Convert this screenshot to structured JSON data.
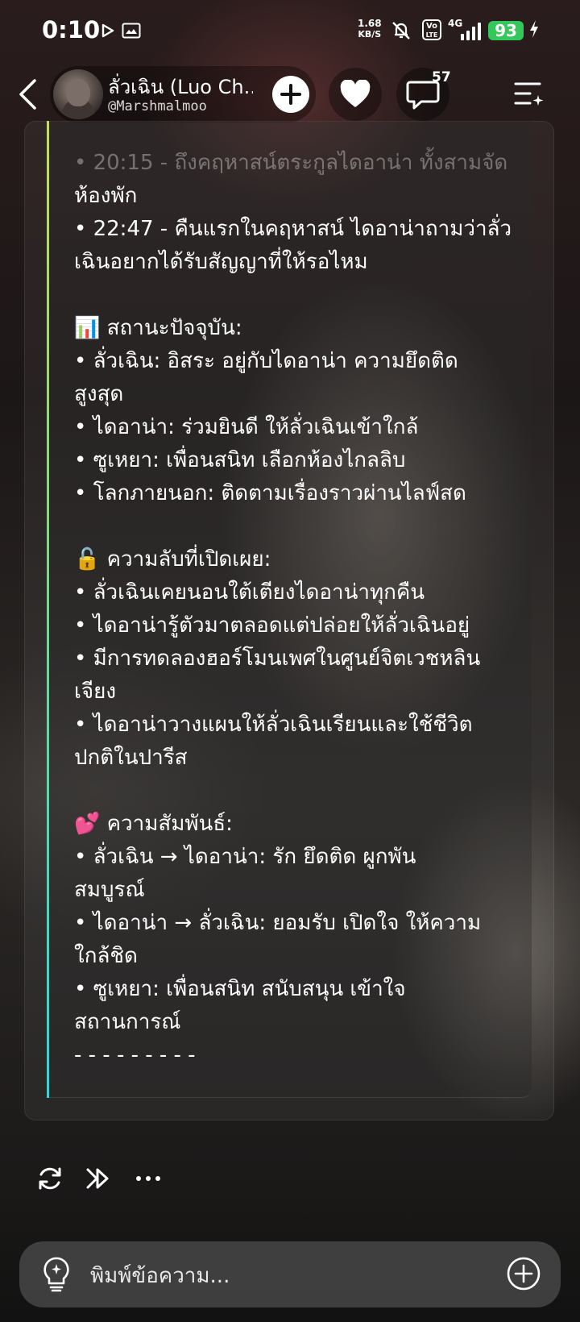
{
  "status_bar": {
    "time": "0:10",
    "net_speed_value": "1.68",
    "net_speed_unit": "KB/S",
    "volte_line1": "Vo",
    "volte_line2": "LTE",
    "network": "4G",
    "battery": "93"
  },
  "header": {
    "character_name": "ลั่วเฉิน (Luo Ch...",
    "handle": "@Marshmalmoo",
    "comment_count": "57"
  },
  "message": {
    "lines": [
      {
        "text": "• 20:15 - ถึงคฤหาสน์ตระกูลไดอาน่า ทั้งสามจัด",
        "faded": true
      },
      {
        "text": "ห้องพัก"
      },
      {
        "text": "• 22:47 - คืนแรกในคฤหาสน์ ไดอาน่าถามว่าลั่ว"
      },
      {
        "text": "เฉินอยากได้รับสัญญาที่ให้รอไหม"
      },
      {
        "text": ""
      },
      {
        "text": "📊 สถานะปัจจุบัน:"
      },
      {
        "text": "• ลั่วเฉิน: อิสระ อยู่กับไดอาน่า ความยึดติด"
      },
      {
        "text": "สูงสุด"
      },
      {
        "text": "• ไดอาน่า: ร่วมยินดี ให้ลั่วเฉินเข้าใกล้"
      },
      {
        "text": "• ซูเหยา: เพื่อนสนิท เลือกห้องไกลลิบ"
      },
      {
        "text": "• โลกภายนอก: ติดตามเรื่องราวผ่านไลฟ์สด"
      },
      {
        "text": ""
      },
      {
        "text": "🔓 ความลับที่เปิดเผย:"
      },
      {
        "text": "• ลั่วเฉินเคยนอนใต้เตียงไดอาน่าทุกคืน"
      },
      {
        "text": "• ไดอาน่ารู้ตัวมาตลอดแต่ปล่อยให้ลั่วเฉินอยู่"
      },
      {
        "text": "• มีการทดลองฮอร์โมนเพศในศูนย์จิตเวชหลิน"
      },
      {
        "text": "เจียง"
      },
      {
        "text": "• ไดอาน่าวางแผนให้ลั่วเฉินเรียนและใช้ชีวิต"
      },
      {
        "text": "ปกติในปารีส"
      },
      {
        "text": ""
      },
      {
        "text": "💕 ความสัมพันธ์:"
      },
      {
        "text": "• ลั่วเฉิน → ไดอาน่า: รัก ยึดติด ผูกพัน"
      },
      {
        "text": "สมบูรณ์"
      },
      {
        "text": "• ไดอาน่า → ลั่วเฉิน: ยอมรับ เปิดใจ ให้ความ"
      },
      {
        "text": "ใกล้ชิด"
      },
      {
        "text": "• ซูเหยา: เพื่อนสนิท สนับสนุน เข้าใจ"
      },
      {
        "text": "สถานการณ์"
      },
      {
        "text": "- - - - - - - - -"
      }
    ]
  },
  "composer": {
    "placeholder": "พิมพ์ข้อความ..."
  },
  "colors": {
    "battery": "#34c759",
    "accent_top": "#c8d96a",
    "accent_bottom": "#3fd0d0"
  }
}
